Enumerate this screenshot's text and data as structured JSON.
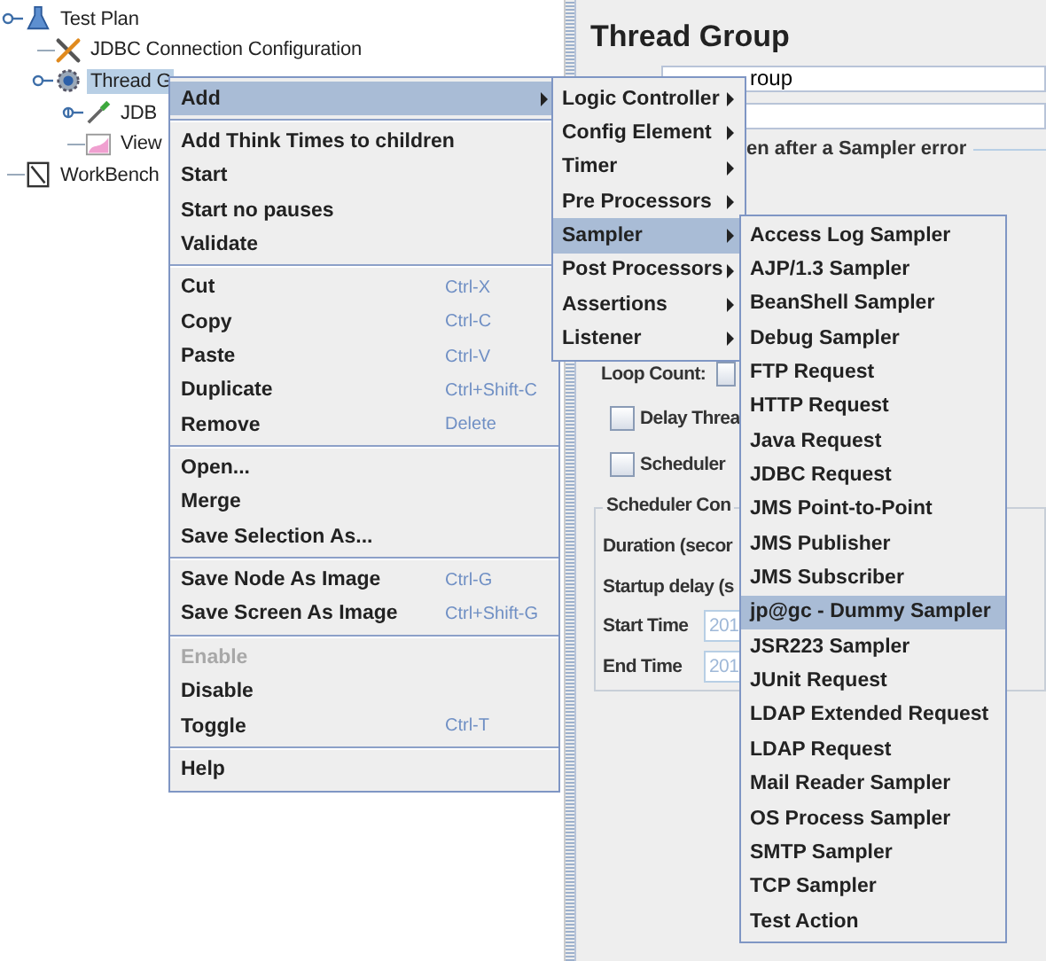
{
  "tree": [
    {
      "label": "Test Plan",
      "kind": "test-plan",
      "selected": false,
      "expanded": true,
      "children": [
        {
          "label": "JDBC Connection Configuration",
          "kind": "config",
          "selected": false
        },
        {
          "label": "Thread G",
          "kind": "thread-group",
          "selected": true,
          "expanded": true,
          "children": [
            {
              "label": "JDB",
              "kind": "sampler",
              "selected": false,
              "expanded": false
            },
            {
              "label": "View",
              "kind": "listener",
              "selected": false
            }
          ]
        }
      ]
    },
    {
      "label": "WorkBench",
      "kind": "workbench",
      "selected": false
    }
  ],
  "panel": {
    "title": "Thread Group",
    "name_value": "roup",
    "error_legend": "en after a Sampler error",
    "loop_label": "Loop Count:",
    "forever_checked": false,
    "delay_label": "Delay Threa",
    "delay_checked": false,
    "scheduler_label": "Scheduler",
    "scheduler_checked": false,
    "scheduler_legend": "Scheduler Con",
    "duration_label": "Duration (secor",
    "startup_label": "Startup delay (s",
    "start_label": "Start Time",
    "start_value": "201",
    "end_label": "End Time",
    "end_value": "201"
  },
  "context_menu": {
    "groups": [
      [
        {
          "label": "Add",
          "submenu": true,
          "selected": true,
          "disabled": false
        }
      ],
      [
        {
          "label": "Add Think Times to children",
          "selected": false,
          "disabled": false
        },
        {
          "label": "Start",
          "selected": false,
          "disabled": false
        },
        {
          "label": "Start no pauses",
          "selected": false,
          "disabled": false
        },
        {
          "label": "Validate",
          "selected": false,
          "disabled": false
        }
      ],
      [
        {
          "label": "Cut",
          "shortcut": "Ctrl-X",
          "selected": false,
          "disabled": false
        },
        {
          "label": "Copy",
          "shortcut": "Ctrl-C",
          "selected": false,
          "disabled": false
        },
        {
          "label": "Paste",
          "shortcut": "Ctrl-V",
          "selected": false,
          "disabled": false
        },
        {
          "label": "Duplicate",
          "shortcut": "Ctrl+Shift-C",
          "selected": false,
          "disabled": false
        },
        {
          "label": "Remove",
          "shortcut": "Delete",
          "selected": false,
          "disabled": false
        }
      ],
      [
        {
          "label": "Open...",
          "selected": false,
          "disabled": false
        },
        {
          "label": "Merge",
          "selected": false,
          "disabled": false
        },
        {
          "label": "Save Selection As...",
          "selected": false,
          "disabled": false
        }
      ],
      [
        {
          "label": "Save Node As Image",
          "shortcut": "Ctrl-G",
          "selected": false,
          "disabled": false
        },
        {
          "label": "Save Screen As Image",
          "shortcut": "Ctrl+Shift-G",
          "selected": false,
          "disabled": false
        }
      ],
      [
        {
          "label": "Enable",
          "selected": false,
          "disabled": true
        },
        {
          "label": "Disable",
          "selected": false,
          "disabled": false
        },
        {
          "label": "Toggle",
          "shortcut": "Ctrl-T",
          "selected": false,
          "disabled": false
        }
      ],
      [
        {
          "label": "Help",
          "selected": false,
          "disabled": false
        }
      ]
    ]
  },
  "add_menu": [
    {
      "label": "Logic Controller",
      "submenu": true,
      "selected": false
    },
    {
      "label": "Config Element",
      "submenu": true,
      "selected": false
    },
    {
      "label": "Timer",
      "submenu": true,
      "selected": false
    },
    {
      "label": "Pre Processors",
      "submenu": true,
      "selected": false
    },
    {
      "label": "Sampler",
      "submenu": true,
      "selected": true
    },
    {
      "label": "Post Processors",
      "submenu": true,
      "selected": false
    },
    {
      "label": "Assertions",
      "submenu": true,
      "selected": false
    },
    {
      "label": "Listener",
      "submenu": true,
      "selected": false
    }
  ],
  "sampler_menu": [
    {
      "label": "Access Log Sampler",
      "selected": false
    },
    {
      "label": "AJP/1.3 Sampler",
      "selected": false
    },
    {
      "label": "BeanShell Sampler",
      "selected": false
    },
    {
      "label": "Debug Sampler",
      "selected": false
    },
    {
      "label": "FTP Request",
      "selected": false
    },
    {
      "label": "HTTP Request",
      "selected": false
    },
    {
      "label": "Java Request",
      "selected": false
    },
    {
      "label": "JDBC Request",
      "selected": false
    },
    {
      "label": "JMS Point-to-Point",
      "selected": false
    },
    {
      "label": "JMS Publisher",
      "selected": false
    },
    {
      "label": "JMS Subscriber",
      "selected": false
    },
    {
      "label": "jp@gc - Dummy Sampler",
      "selected": true
    },
    {
      "label": "JSR223 Sampler",
      "selected": false
    },
    {
      "label": "JUnit Request",
      "selected": false
    },
    {
      "label": "LDAP Extended Request",
      "selected": false
    },
    {
      "label": "LDAP Request",
      "selected": false
    },
    {
      "label": "Mail Reader Sampler",
      "selected": false
    },
    {
      "label": "OS Process Sampler",
      "selected": false
    },
    {
      "label": "SMTP Sampler",
      "selected": false
    },
    {
      "label": "TCP Sampler",
      "selected": false
    },
    {
      "label": "Test Action",
      "selected": false
    }
  ]
}
